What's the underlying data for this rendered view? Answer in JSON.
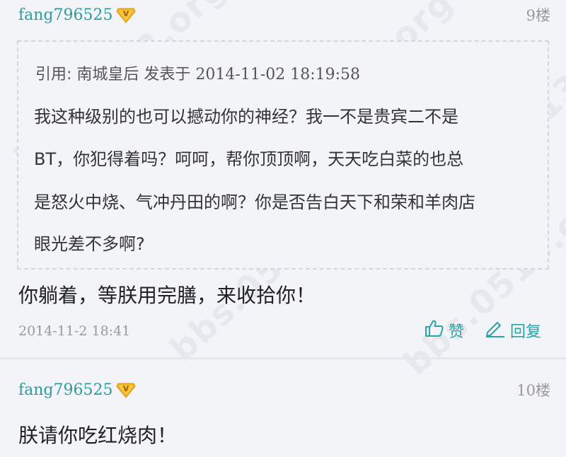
{
  "posts": [
    {
      "username": "fang796525",
      "floor": "9楼",
      "quote": {
        "header_label": "引用: 南城皇后 发表于 ",
        "header_date": "2014-11-02 18:19:58",
        "lines": [
          "我这种级别的也可以撼动你的神经？我一不是贵宾二不是",
          "BT，你犯得着吗？呵呵，帮你顶顶啊，天天吃白菜的也总",
          "是怒火中烧、气冲丹田的啊？你是否告白天下和荣和羊肉店",
          "眼光差不多啊?"
        ]
      },
      "content": "你躺着，等朕用完膳，来收拾你！",
      "date": "2014-11-2 18:41",
      "like_label": "赞",
      "reply_label": "回复"
    },
    {
      "username": "fang796525",
      "floor": "10楼",
      "content": "朕请你吃红烧肉！"
    }
  ],
  "watermark_text": "bbs.0513.org",
  "colors": {
    "accent": "#2aa4a7",
    "username": "#2e9c9e",
    "badge": "#f2b21c",
    "background": "#f3f4f8"
  },
  "icons": {
    "badge": "vip-v-badge-icon",
    "like": "thumbs-up-icon",
    "reply": "edit-pencil-icon"
  }
}
